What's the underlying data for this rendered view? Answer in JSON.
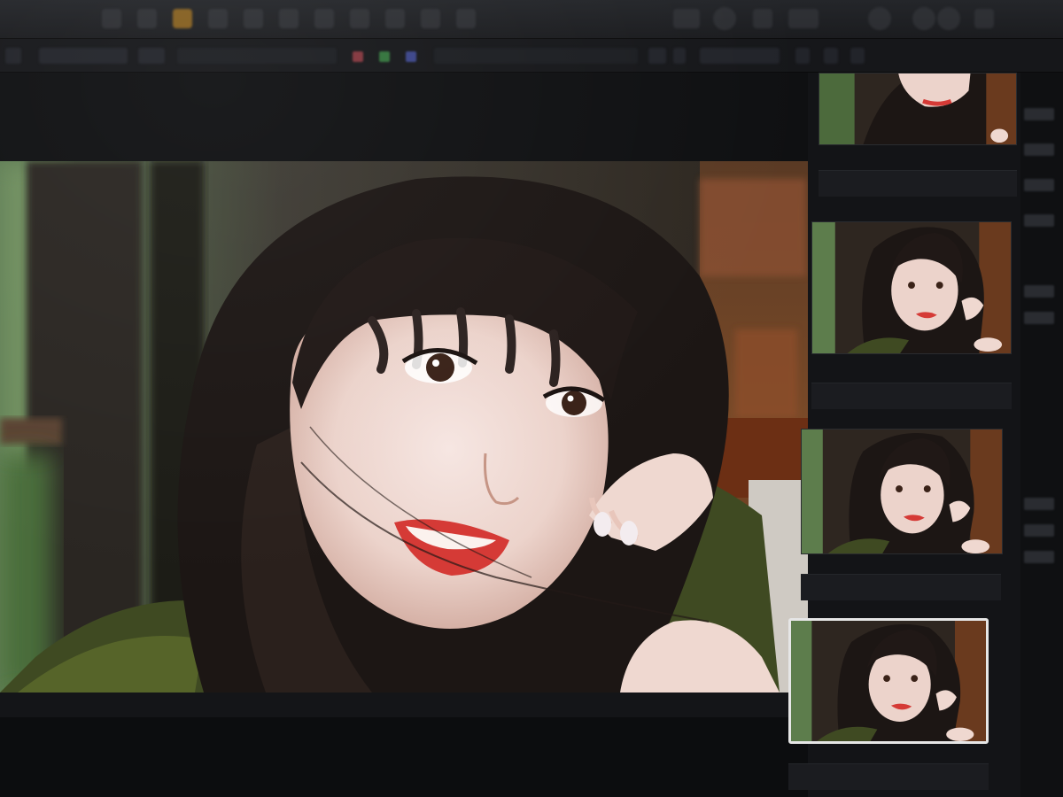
{
  "toolbar": {
    "tools": [
      "move-tool-icon",
      "lasso-icon",
      "crop-icon",
      "brush-icon",
      "stamp-icon",
      "heal-icon",
      "eraser-icon",
      "pen-icon",
      "text-icon",
      "shape-icon",
      "zoom-icon"
    ],
    "right_tools": [
      "window-icon",
      "circle-icon",
      "gear-icon",
      "layers-icon"
    ]
  },
  "strip": {
    "preset_label": "",
    "zoom_label": "",
    "filter_label": ""
  },
  "viewer": {
    "status_left": "",
    "status_center": ""
  },
  "filmstrip": {
    "thumbnails": [
      {
        "label": "",
        "selected": false
      },
      {
        "label": "",
        "selected": false
      },
      {
        "label": "",
        "selected": false
      },
      {
        "label": "",
        "selected": true
      }
    ]
  },
  "colors": {
    "accent": "#b07a1e",
    "selection": "#e6e6e6",
    "background": "#101114"
  }
}
